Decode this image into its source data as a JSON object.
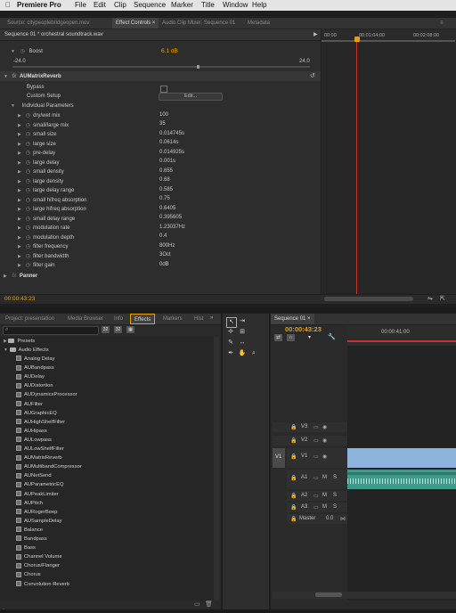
{
  "menubar": {
    "apple_icon": "apple-icon",
    "app_name": "Premiere Pro",
    "items": [
      "File",
      "Edit",
      "Clip",
      "Sequence",
      "Marker",
      "Title",
      "Window",
      "Help"
    ]
  },
  "top_tabs": [
    "Source: citypeoplebridgeopen.mov",
    "Effect Controls",
    "Audio Clip Mixer: Sequence 01",
    "Metadata"
  ],
  "effect_controls": {
    "clip_path": "Sequence 01 * orchestral soundtrack.wav",
    "ruler": [
      "00:00",
      "00:01:04:00",
      "00:02:08:00"
    ],
    "boost": {
      "label": "Boost",
      "value": "6.1 dB",
      "min": "-24.0",
      "max": "24.0"
    },
    "effect_name": "AUMatrixReverb",
    "bypass_label": "Bypass",
    "custom_setup_label": "Custom Setup",
    "edit_button": "Edit...",
    "individual_params_label": "Individual Parameters",
    "params": [
      {
        "name": "dry/wet mix",
        "value": "100"
      },
      {
        "name": "small/large mix",
        "value": "35"
      },
      {
        "name": "small size",
        "value": "0.014745s"
      },
      {
        "name": "large size",
        "value": "0.0614s"
      },
      {
        "name": "pre-delay",
        "value": "0.014925s"
      },
      {
        "name": "large delay",
        "value": "0.001s"
      },
      {
        "name": "small density",
        "value": "0.655"
      },
      {
        "name": "large density",
        "value": "0.68"
      },
      {
        "name": "large delay range",
        "value": "0.585"
      },
      {
        "name": "small hifreq absorption",
        "value": "0.75"
      },
      {
        "name": "large hifreq absorption",
        "value": "0.6405"
      },
      {
        "name": "small delay range",
        "value": "0.395605"
      },
      {
        "name": "modulation rate",
        "value": "1.23037Hz"
      },
      {
        "name": "modulation depth",
        "value": "0.4"
      },
      {
        "name": "filter frequency",
        "value": "800Hz"
      },
      {
        "name": "filter bandwidth",
        "value": "3Oct"
      },
      {
        "name": "filter gain",
        "value": "0dB"
      }
    ],
    "panner_label": "Panner",
    "timecode": "00:00:43:23"
  },
  "project_panel": {
    "tabs": [
      "Project: presentation",
      "Media Browser",
      "Info",
      "Effects",
      "Markers",
      "Hist"
    ],
    "search_placeholder": "",
    "presets_label": "Presets",
    "audio_effects_label": "Audio Effects",
    "effects": [
      "Analog Delay",
      "AUBandpass",
      "AUDelay",
      "AUDistortion",
      "AUDynamicsProcessor",
      "AUFilter",
      "AUGraphicEQ",
      "AUHighShelfFilter",
      "AUHipass",
      "AULowpass",
      "AULowShelfFilter",
      "AUMatrixReverb",
      "AUMultibandCompressor",
      "AUNetSend",
      "AUParametricEQ",
      "AUPeakLimiter",
      "AUPitch",
      "AURogerBeep",
      "AUSampleDelay",
      "Balance",
      "Bandpass",
      "Bass",
      "Channel Volume",
      "Chorus/Flanger",
      "Chorus",
      "Convolution Reverb"
    ]
  },
  "timeline": {
    "tab": "Sequence 01",
    "timecode": "00:00:43:23",
    "ruler_time": "00:00:41:00",
    "tracks": {
      "v3": "V3",
      "v2": "V2",
      "v1": "V1",
      "v1_source": "V1",
      "a1": "A1",
      "a2": "A2",
      "a3": "A3",
      "master": "Master",
      "master_value": "0.0",
      "m": "M",
      "s": "S"
    }
  },
  "colors": {
    "accent_orange": "#e8a100",
    "playhead_red": "#c8322a",
    "clip_blue": "#8fb4dc",
    "audio_teal": "#3e9a8a"
  }
}
